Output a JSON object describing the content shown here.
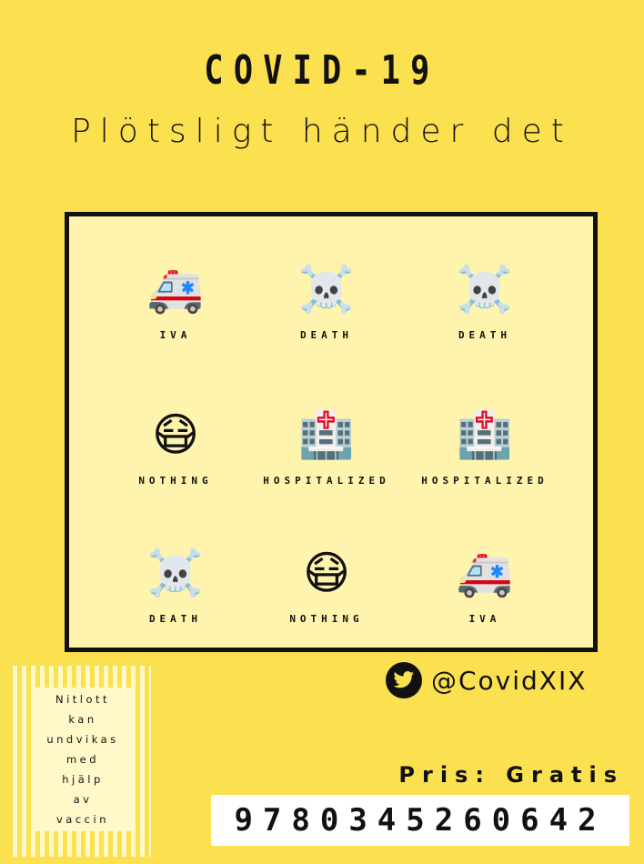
{
  "header": {
    "title": "COVID-19",
    "subtitle": "Plötsligt händer det"
  },
  "grid": {
    "cells": [
      {
        "icon": "ambulance-icon",
        "glyph": "🚑",
        "label": "IVA"
      },
      {
        "icon": "skull-crossbones-icon",
        "glyph": "☠️",
        "label": "DEATH"
      },
      {
        "icon": "skull-crossbones-icon",
        "glyph": "☠️",
        "label": "DEATH"
      },
      {
        "icon": "medical-mask-face-icon",
        "glyph": "😷",
        "label": "NOTHING"
      },
      {
        "icon": "hospital-icon",
        "glyph": "🏥",
        "label": "HOSPITALIZED"
      },
      {
        "icon": "hospital-icon",
        "glyph": "🏥",
        "label": "HOSPITALIZED"
      },
      {
        "icon": "skull-crossbones-icon",
        "glyph": "☠️",
        "label": "DEATH"
      },
      {
        "icon": "medical-mask-face-icon",
        "glyph": "😷",
        "label": "NOTHING"
      },
      {
        "icon": "ambulance-icon",
        "glyph": "🚑",
        "label": "IVA"
      }
    ]
  },
  "social": {
    "icon": "twitter-icon",
    "handle": "@CovidXIX"
  },
  "slogan": {
    "lines": [
      "Nitlott",
      "kan",
      "undvikas",
      "med",
      "hjälp",
      "av",
      "vaccin"
    ]
  },
  "price": {
    "text": "Pris: Gratis"
  },
  "isbn": {
    "number": "9780345260642"
  },
  "colors": {
    "background": "#fbe04f",
    "card": "#fff4ad",
    "text": "#111111"
  }
}
